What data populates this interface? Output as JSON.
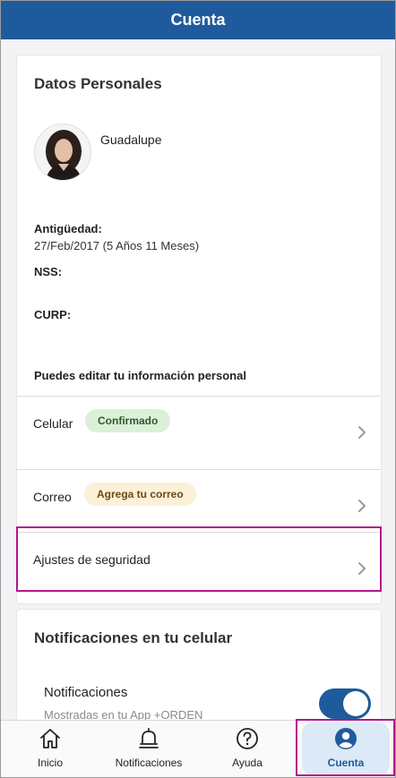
{
  "header": {
    "title": "Cuenta"
  },
  "personal": {
    "section_title": "Datos Personales",
    "name": "Guadalupe",
    "seniority_label": "Antigüedad:",
    "seniority_value": "27/Feb/2017 (5 Años 11 Meses)",
    "nss_label": "NSS:",
    "curp_label": "CURP:",
    "edit_note": "Puedes editar tu información personal"
  },
  "rows": {
    "phone": {
      "label": "Celular",
      "badge": "Confirmado"
    },
    "email": {
      "label": "Correo",
      "badge": "Agrega tu correo"
    },
    "security": {
      "label": "Ajustes de seguridad"
    }
  },
  "notifications": {
    "section_title": "Notificaciones en tu celular",
    "label": "Notificaciones",
    "subtitle": "Mostradas en tu App +ORDEN",
    "enabled": true
  },
  "tabbar": {
    "items": [
      {
        "label": "Inicio",
        "icon": "home-icon"
      },
      {
        "label": "Notificaciones",
        "icon": "bell-icon"
      },
      {
        "label": "Ayuda",
        "icon": "help-icon"
      },
      {
        "label": "Cuenta",
        "icon": "account-icon",
        "active": true
      }
    ]
  },
  "colors": {
    "brand": "#1f5b9c",
    "highlight": "#b3168d",
    "badge_ok_bg": "#dcefd9",
    "badge_warn_bg": "#fbf0d8"
  }
}
